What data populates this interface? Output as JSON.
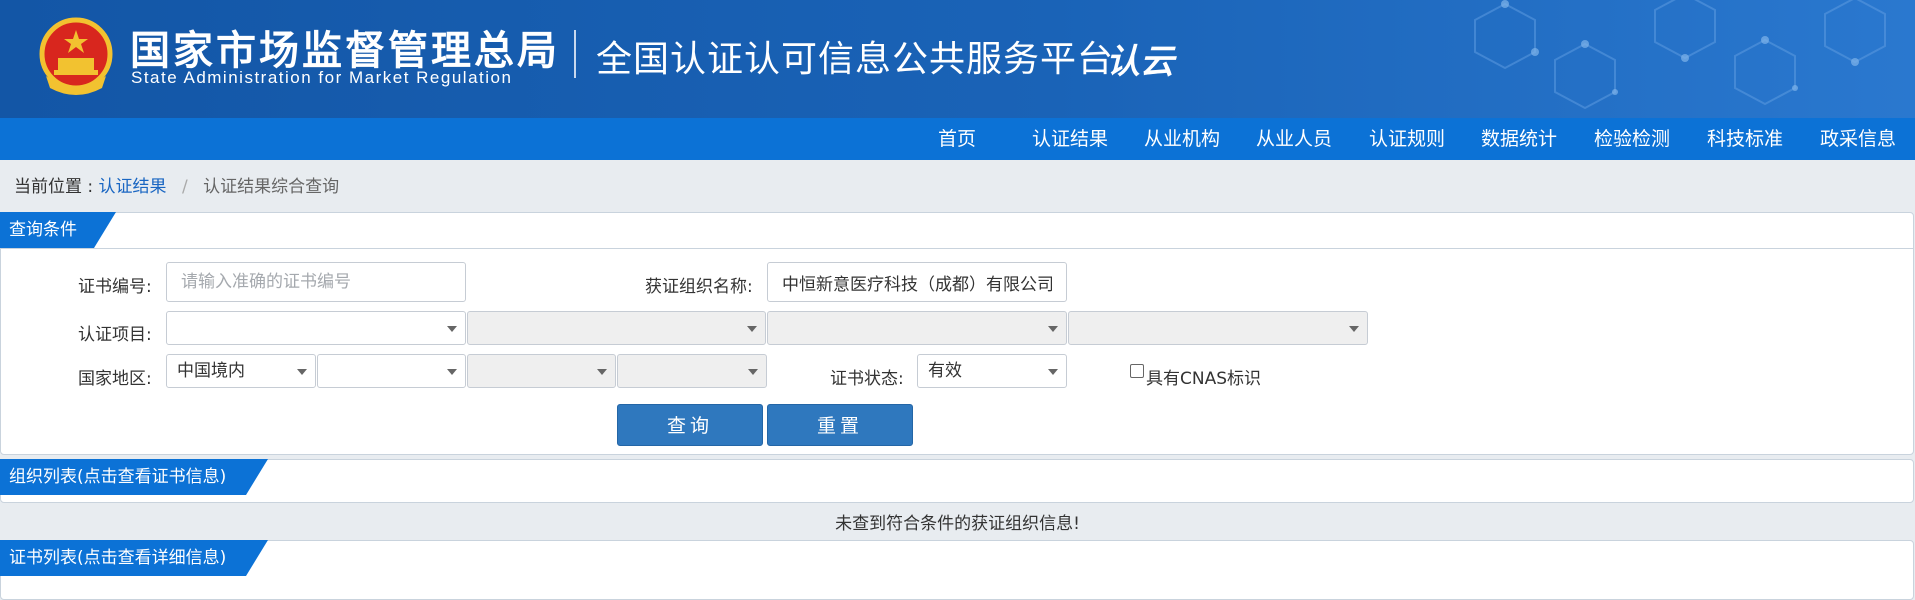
{
  "header": {
    "org_name_cn": "国家市场监督管理总局",
    "org_name_en": "State Administration for Market Regulation",
    "platform_title": "全国认证认可信息公共服务平台",
    "logo_text": "认云"
  },
  "nav": {
    "items": [
      {
        "label": "首页"
      },
      {
        "label": "认证结果"
      },
      {
        "label": "从业机构"
      },
      {
        "label": "从业人员"
      },
      {
        "label": "认证规则"
      },
      {
        "label": "数据统计"
      },
      {
        "label": "检验检测"
      },
      {
        "label": "科技标准"
      },
      {
        "label": "政采信息"
      }
    ]
  },
  "breadcrumb": {
    "prefix": "当前位置 :",
    "link": "认证结果",
    "separator": "/",
    "current": "认证结果综合查询"
  },
  "query_panel": {
    "tab_label": "查询条件",
    "cert_no_label": "证书编号:",
    "cert_no_placeholder": "请输入准确的证书编号",
    "org_name_label": "获证组织名称:",
    "org_name_value": "中恒新意医疗科技（成都）有限公司",
    "project_label": "认证项目:",
    "region_label": "国家地区:",
    "region_value": "中国境内",
    "status_label": "证书状态:",
    "status_value": "有效",
    "cnas_label": "具有CNAS标识",
    "query_button": "查询",
    "reset_button": "重置"
  },
  "org_list": {
    "tab_label": "组织列表(点击查看证书信息)",
    "empty_message": "未查到符合条件的获证组织信息!"
  },
  "cert_list": {
    "tab_label": "证书列表(点击查看详细信息)"
  },
  "colors": {
    "brand_blue": "#0c72d6",
    "banner_blue": "#1356a6",
    "button_blue": "#2f78be"
  }
}
